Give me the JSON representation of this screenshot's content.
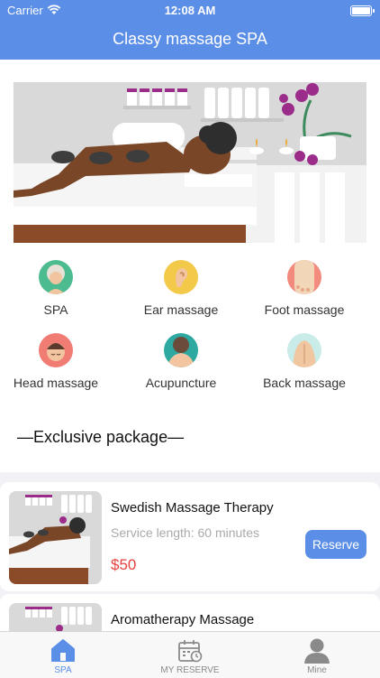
{
  "status": {
    "carrier": "Carrier",
    "time": "12:08 AM"
  },
  "nav": {
    "title": "Classy massage SPA"
  },
  "categories": [
    {
      "label": "SPA",
      "icon": "spa-face-icon"
    },
    {
      "label": "Ear massage",
      "icon": "ear-icon"
    },
    {
      "label": "Foot massage",
      "icon": "foot-icon"
    },
    {
      "label": "Head massage",
      "icon": "head-icon"
    },
    {
      "label": "Acupuncture",
      "icon": "neck-icon"
    },
    {
      "label": "Back massage",
      "icon": "back-icon"
    }
  ],
  "section": {
    "title": "—Exclusive package—"
  },
  "packages": [
    {
      "name": "Swedish Massage Therapy",
      "length": "Service length: 60 minutes",
      "price": "$50",
      "button": "Reserve"
    },
    {
      "name": "Aromatherapy Massage"
    }
  ],
  "tabs": [
    {
      "label": "SPA",
      "icon": "home-icon",
      "active": true
    },
    {
      "label": "MY RESERVE",
      "icon": "calendar-icon",
      "active": false
    },
    {
      "label": "Mine",
      "icon": "person-icon",
      "active": false
    }
  ],
  "colors": {
    "accent": "#5b8ee6",
    "price": "#e6413f"
  }
}
